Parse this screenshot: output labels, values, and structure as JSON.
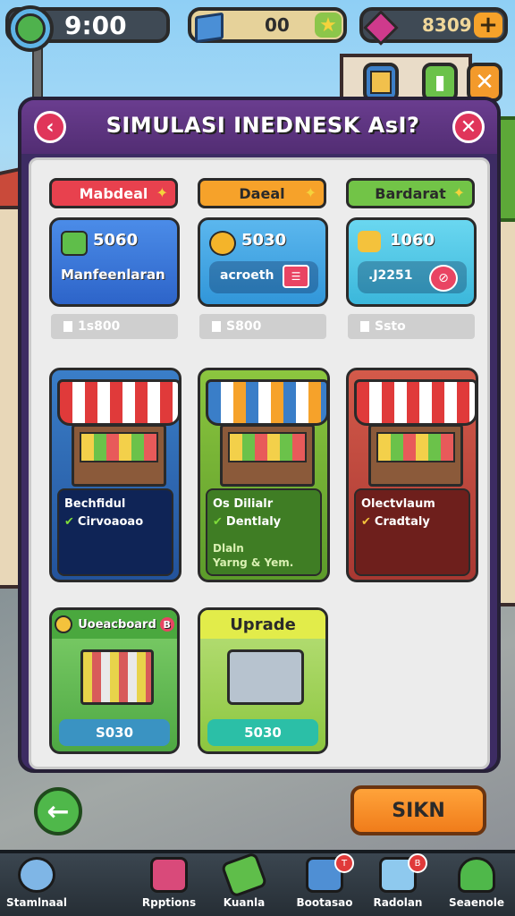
{
  "hud": {
    "time": "9:00",
    "gems_value": "00",
    "gems_plus": "★",
    "coins_value": "8309",
    "coins_plus": "+"
  },
  "top_buttons": {
    "close_symbol": "✕"
  },
  "panel": {
    "title": "SIMULASI INEDNESK AsI?",
    "back_symbol": "‹",
    "close_symbol": "✕"
  },
  "tabs": [
    {
      "label": "Mabdeal",
      "color": "#e8414e"
    },
    {
      "label": "Daeal",
      "color": "#f6a22a"
    },
    {
      "label": "Bardarat",
      "color": "#72c447"
    }
  ],
  "stat_cards": [
    {
      "value": "5060",
      "label": "Manfeenlaran",
      "icon": "green-box-icon",
      "price": "1s800"
    },
    {
      "value": "5030",
      "label": "acroeth",
      "icon": "gear-icon",
      "price": "S800"
    },
    {
      "value": "1060",
      "label": ".J2251",
      "icon": "star-icon",
      "price": "Ssto"
    }
  ],
  "stalls": [
    {
      "line1": "Bechfidul",
      "line2": "Cirvoaoao",
      "line3": "",
      "line4": "",
      "color": "#3a7ec8"
    },
    {
      "line1": "Os Dilialr",
      "line2": "Dentlaly",
      "line3": "Dlaln",
      "line4": "Yarng & Yem.",
      "color": "#8cc63f"
    },
    {
      "line1": "Olectvlaum",
      "line2": "Cradtaly",
      "line3": "",
      "line4": "",
      "color": "#d45a4a"
    }
  ],
  "upgrades": [
    {
      "header": "Uoeacboard",
      "badge": "B",
      "price": "S030"
    },
    {
      "header": "Uprade",
      "price": "5030"
    }
  ],
  "bottom": {
    "back_symbol": "←",
    "skin_label": "SIKN"
  },
  "nav": [
    {
      "label": "Stamlnaal",
      "icon": "gear-icon"
    },
    {
      "label": "Rpptions",
      "icon": "shop-icon"
    },
    {
      "label": "Kuanla",
      "icon": "ticket-icon"
    },
    {
      "label": "Bootasao",
      "icon": "box-icon",
      "badge": "T"
    },
    {
      "label": "Radolan",
      "icon": "crate-icon",
      "badge": "B"
    },
    {
      "label": "Seaenole",
      "icon": "star-icon"
    }
  ]
}
